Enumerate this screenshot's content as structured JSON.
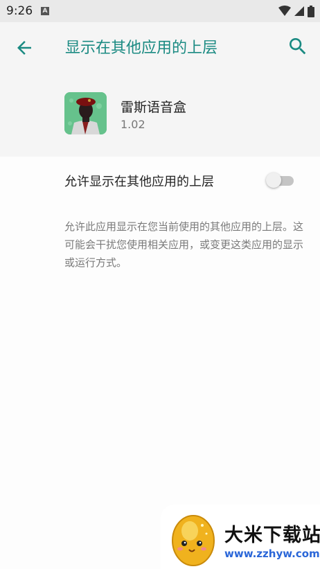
{
  "status_bar": {
    "time": "9:26",
    "notification_glyph": "A",
    "icons": [
      "wifi-icon",
      "cellular-signal-icon",
      "battery-icon"
    ]
  },
  "app_bar": {
    "title": "显示在其他应用的上层",
    "back_icon": "arrow-left-icon",
    "search_icon": "search-icon",
    "accent_color": "#1a8a82"
  },
  "app_info": {
    "name": "雷斯语音盒",
    "version": "1.02"
  },
  "permission": {
    "label": "允许显示在其他应用的上层",
    "enabled": false,
    "description": "允许此应用显示在您当前使用的其他应用的上层。这可能会干扰您使用相关应用，或变更这类应用的显示或运行方式。"
  },
  "watermark": {
    "brand": "大米下载站",
    "url": "www.zzhyw.com"
  }
}
